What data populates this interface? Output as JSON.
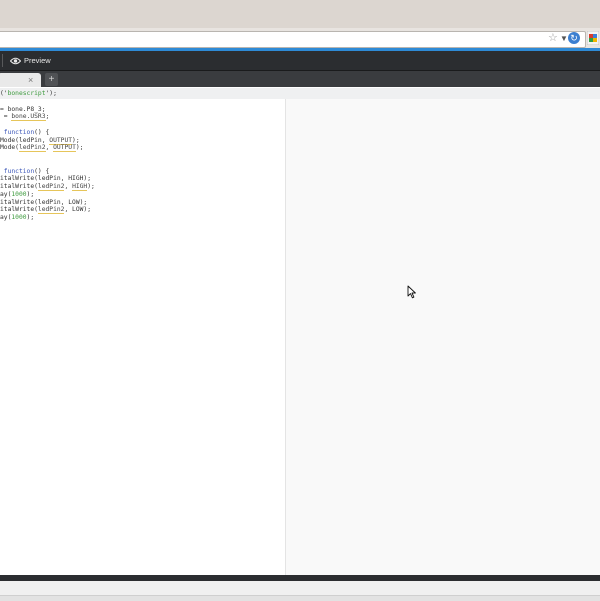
{
  "toolbar": {
    "preview_label": "Preview",
    "new_tab_label": "+",
    "tab_close_label": "×"
  },
  "editor": {
    "lines": [
      {
        "segments": [
          {
            "t": "('",
            "c": "cl"
          },
          {
            "t": "bonescript",
            "c": "str"
          },
          {
            "t": "');",
            "c": "cl"
          }
        ]
      },
      {
        "segments": []
      },
      {
        "segments": [
          {
            "t": "= bone.P8_3;",
            "c": "cl"
          }
        ]
      },
      {
        "segments": [
          {
            "t": " = ",
            "c": "cl"
          },
          {
            "t": "bone.USR3",
            "c": "und"
          },
          {
            "t": ";",
            "c": "cl"
          }
        ]
      },
      {
        "segments": []
      },
      {
        "segments": [
          {
            "t": " ",
            "c": "cl"
          },
          {
            "t": "function",
            "c": "kw"
          },
          {
            "t": "() {",
            "c": "cl"
          }
        ]
      },
      {
        "segments": [
          {
            "t": "Mode(ledPin, ",
            "c": "cl"
          },
          {
            "t": "OUTPUT",
            "c": "und"
          },
          {
            "t": ");",
            "c": "cl"
          }
        ]
      },
      {
        "segments": [
          {
            "t": "Mode(",
            "c": "cl"
          },
          {
            "t": "ledPin2",
            "c": "und"
          },
          {
            "t": ", ",
            "c": "cl"
          },
          {
            "t": "OUTPUT",
            "c": "und"
          },
          {
            "t": ");",
            "c": "cl"
          }
        ]
      },
      {
        "segments": []
      },
      {
        "segments": []
      },
      {
        "segments": [
          {
            "t": " ",
            "c": "cl"
          },
          {
            "t": "function",
            "c": "kw"
          },
          {
            "t": "() {",
            "c": "cl"
          }
        ]
      },
      {
        "segments": [
          {
            "t": "italWrite(ledPin, HIGH);",
            "c": "cl"
          }
        ]
      },
      {
        "segments": [
          {
            "t": "italWrite(",
            "c": "cl"
          },
          {
            "t": "ledPin2",
            "c": "und"
          },
          {
            "t": ", ",
            "c": "cl"
          },
          {
            "t": "HIGH",
            "c": "und"
          },
          {
            "t": ");",
            "c": "cl"
          }
        ]
      },
      {
        "segments": [
          {
            "t": "ay(",
            "c": "cl"
          },
          {
            "t": "1000",
            "c": "num"
          },
          {
            "t": ");",
            "c": "cl"
          }
        ]
      },
      {
        "segments": [
          {
            "t": "italWrite(ledPin, LOW);",
            "c": "cl"
          }
        ]
      },
      {
        "segments": [
          {
            "t": "italWrite(",
            "c": "cl"
          },
          {
            "t": "ledPin2",
            "c": "und"
          },
          {
            "t": ", LOW);",
            "c": "cl"
          }
        ]
      },
      {
        "segments": [
          {
            "t": "ay(",
            "c": "cl"
          },
          {
            "t": "1000",
            "c": "num"
          },
          {
            "t": ");",
            "c": "cl"
          }
        ]
      }
    ]
  },
  "colors": {
    "accent_blue": "#2e8ad6",
    "header_dark": "#2b2d30",
    "keyword": "#3b56b8",
    "string": "#3d9a3d"
  },
  "icons": {
    "preview": "eye-icon",
    "bookmark": "star-icon",
    "reload": "reload-icon",
    "extension": "extension-icon",
    "pointer": "mouse-cursor-icon"
  }
}
